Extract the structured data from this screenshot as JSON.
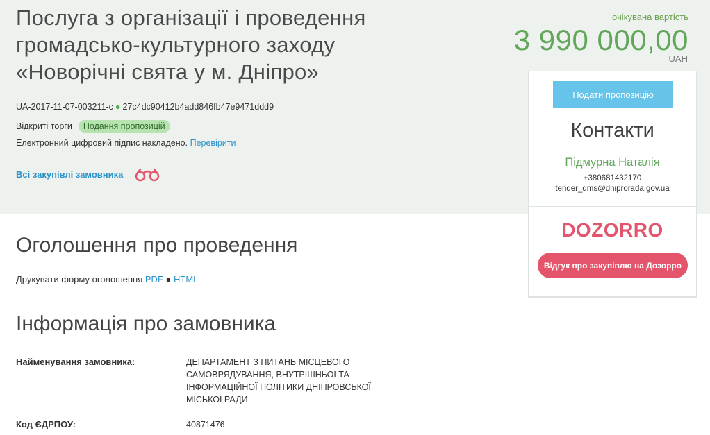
{
  "tender": {
    "title": "Послуга з організації і проведення громадсько-культурного заходу «Новорічні свята у м. Дніпро»",
    "id": "UA-2017-11-07-003211-c",
    "hash": "27c4dc90412b4add846fb47e9471ddd9",
    "procedure": "Відкриті торги",
    "status": "Подання пропозицій",
    "signature_text": "Електронний цифровий підпис накладено.",
    "verify_link": "Перевірити",
    "all_purchases_link": "Всі закупівлі замовника"
  },
  "price": {
    "caption": "очікувана вартість",
    "value": "3 990 000,00",
    "currency": "UAH"
  },
  "contacts": {
    "submit_button": "Подати пропозицію",
    "title": "Контакти",
    "name": "Підмурна Наталія",
    "phone": "+380681432170",
    "email": "tender_dms@dniprorada.gov.ua"
  },
  "dozorro": {
    "logo": "DOZORRO",
    "button": "Відгук про закупівлю на Дозорро"
  },
  "announcement": {
    "title": "Оголошення про проведення",
    "print_label": "Друкувати форму оголошення",
    "pdf": "PDF",
    "html": "HTML"
  },
  "customer": {
    "title": "Інформація про замовника",
    "name_label": "Найменування замовника:",
    "name_value": "ДЕПАРТАМЕНТ З ПИТАНЬ МІСЦЕВОГО САМОВРЯДУВАННЯ, ВНУТРІШНЬОЇ ТА ІНФОРМАЦІЙНОЇ ПОЛІТИКИ ДНІПРОВСЬКОЇ МІСЬКОЇ РАДИ",
    "code_label": "Код ЄДРПОУ:",
    "code_value": "40871476"
  },
  "colors": {
    "accent_green": "#62a65a",
    "link_blue": "#2b91c9",
    "submit_blue": "#66c3e9",
    "dozorro_red": "#e4546b",
    "status_badge_bg": "#b7e3b0"
  }
}
